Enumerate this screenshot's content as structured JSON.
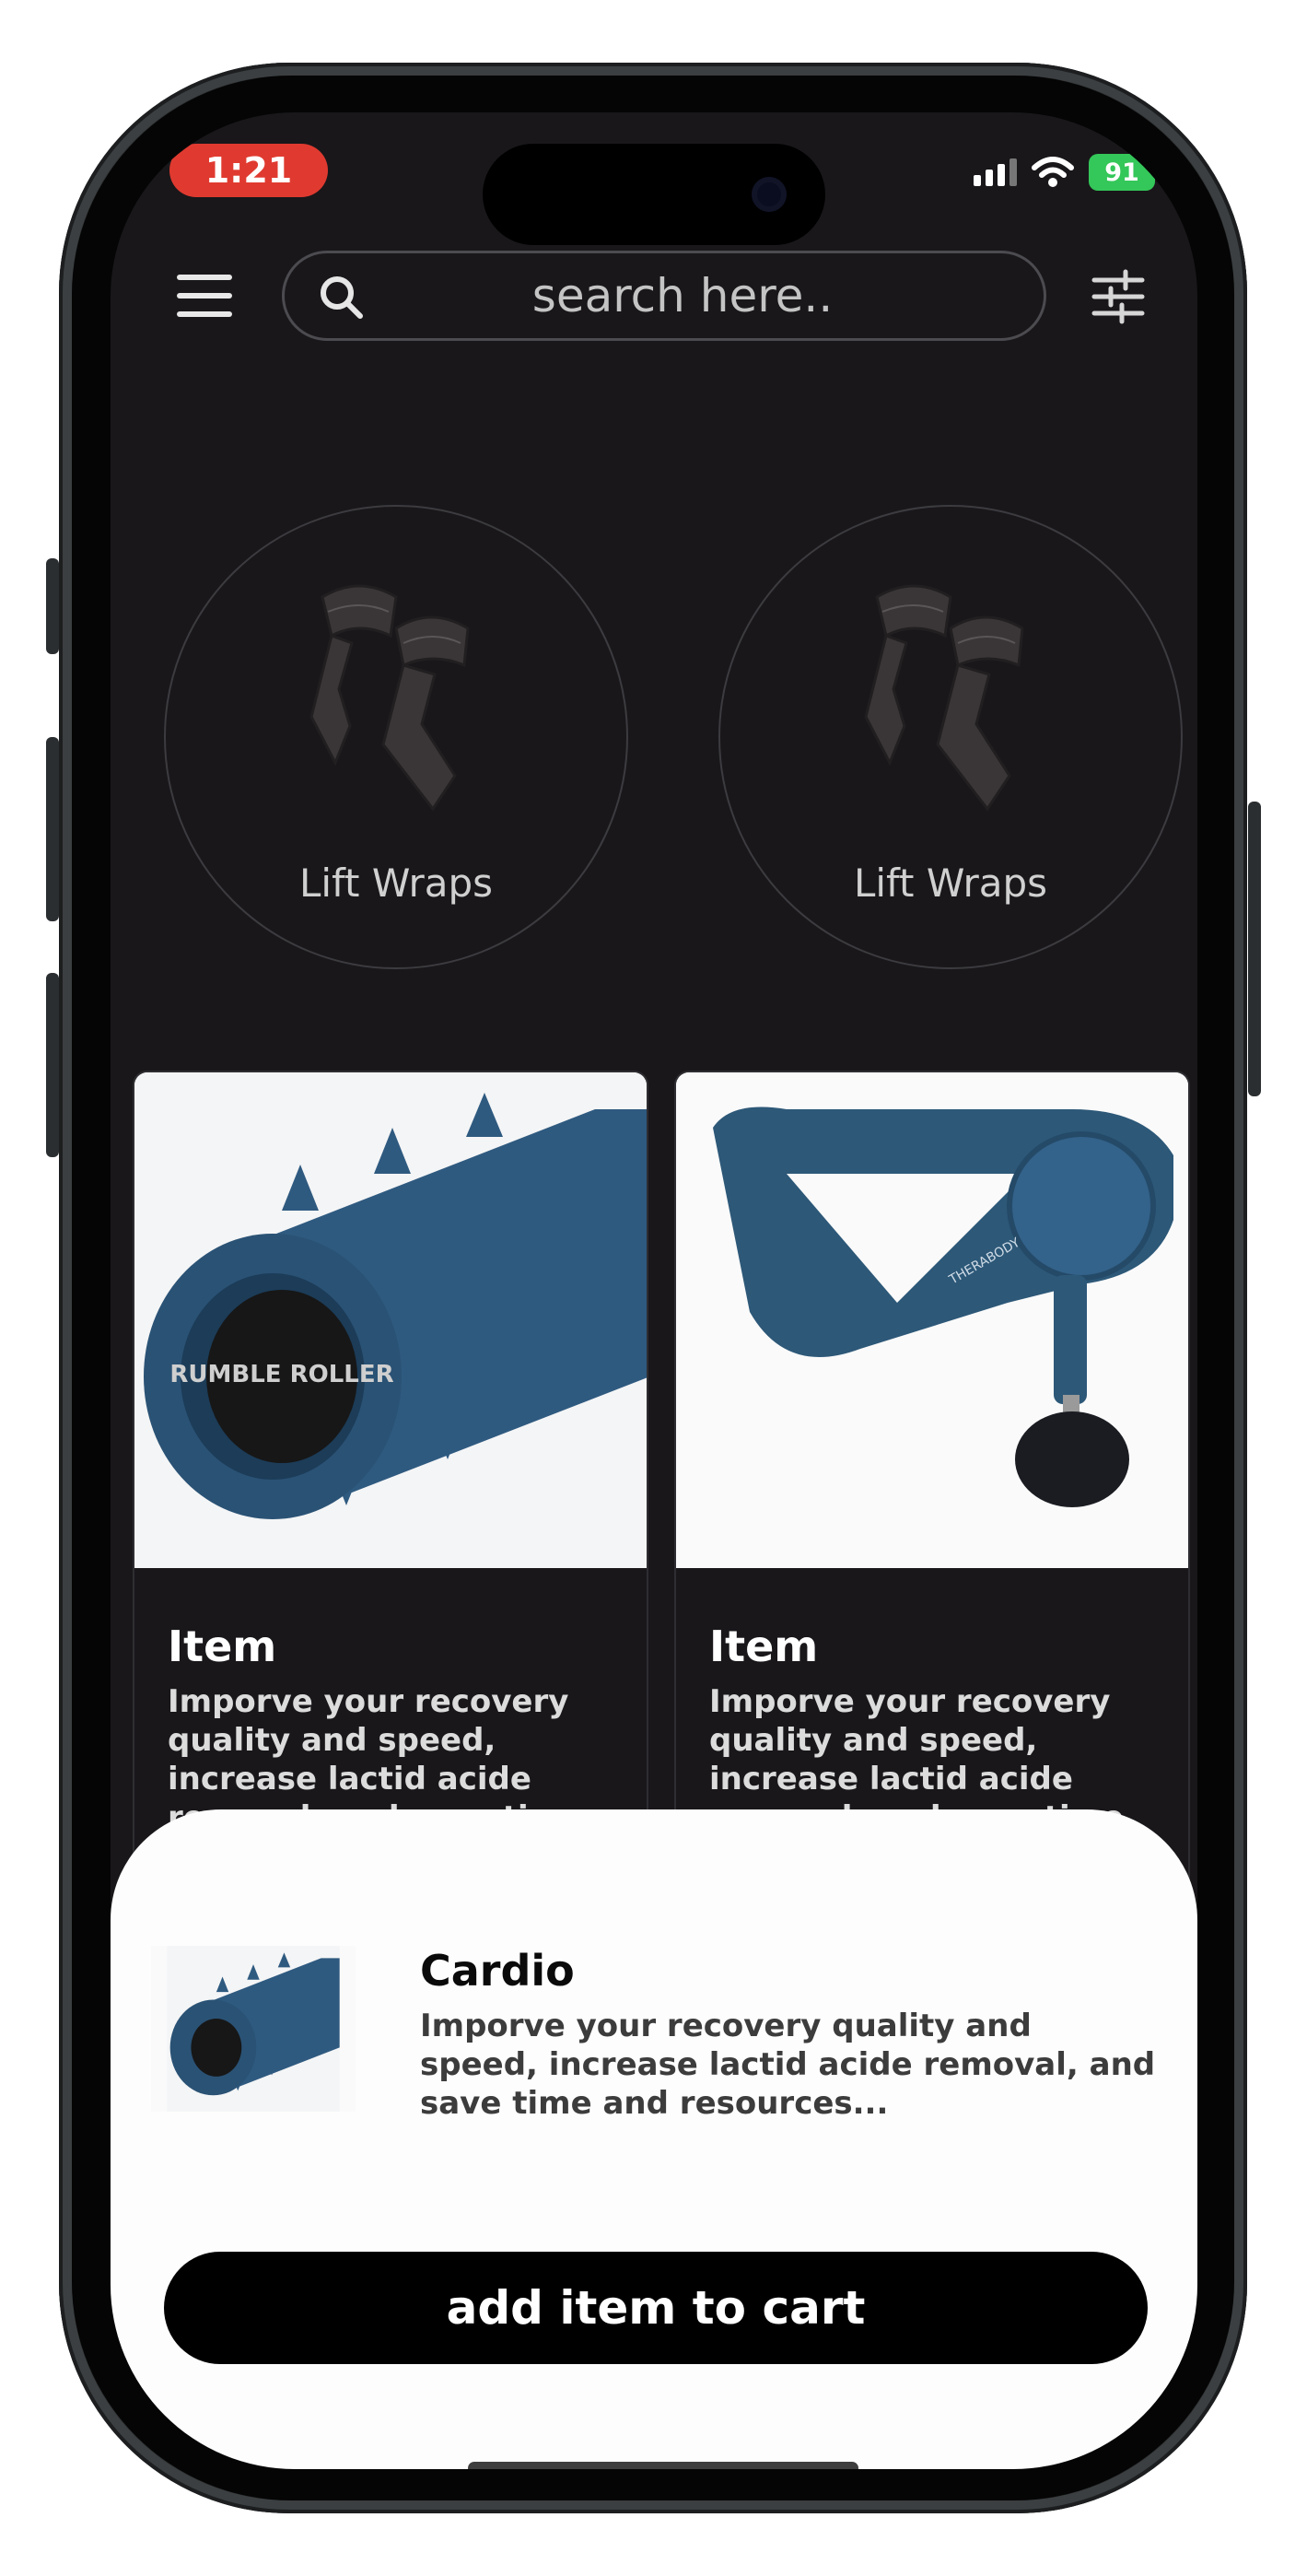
{
  "status_bar": {
    "time": "1:21",
    "battery": "91"
  },
  "search": {
    "placeholder": "search here.."
  },
  "categories": [
    {
      "label": "Lift Wraps",
      "icon": "lift-wraps"
    },
    {
      "label": "Lift Wraps",
      "icon": "lift-wraps"
    }
  ],
  "products": [
    {
      "title": "Item",
      "description": "Imporve your recovery quality and speed, increase lactid acide removal, and save time and resources",
      "image": "foam-roller",
      "brand_text": "RUMBLE ROLLER"
    },
    {
      "title": "Item",
      "description": "Imporve your recovery quality and speed, increase lactid acide removal, and save time and resources",
      "image": "massage-gun",
      "brand_text": "THERABODY"
    }
  ],
  "sheet": {
    "title": "Cardio",
    "description": "Imporve your recovery quality and speed, increase lactid acide removal, and save time and resources...",
    "image": "foam-roller",
    "button_label": "add item to cart"
  },
  "colors": {
    "screen_bg": "#19171a",
    "time_pill": "#e03a30",
    "battery": "#34c759",
    "product_blue": "#2f5a80"
  }
}
